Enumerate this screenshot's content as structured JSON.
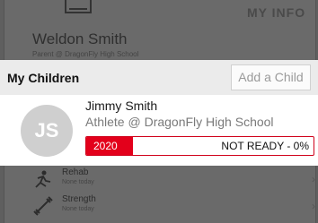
{
  "background": {
    "my_info": "MY INFO",
    "user_name": "Weldon Smith",
    "user_school": "Parent @ DragonFly High School",
    "list": [
      {
        "title": "Rehab",
        "subtitle": "None today",
        "icon": "rehab-icon"
      },
      {
        "title": "Strength",
        "subtitle": "None today",
        "icon": "strength-icon"
      }
    ]
  },
  "modal": {
    "title": "My Children",
    "add_child_label": "Add a Child",
    "child": {
      "initials": "JS",
      "name": "Jimmy Smith",
      "role": "Athlete @ DragonFly High School",
      "year": "2020",
      "status": "NOT READY - 0%",
      "progress": 0
    }
  },
  "colors": {
    "accent": "#e3001b",
    "avatar_bg": "#cfcfcf"
  }
}
